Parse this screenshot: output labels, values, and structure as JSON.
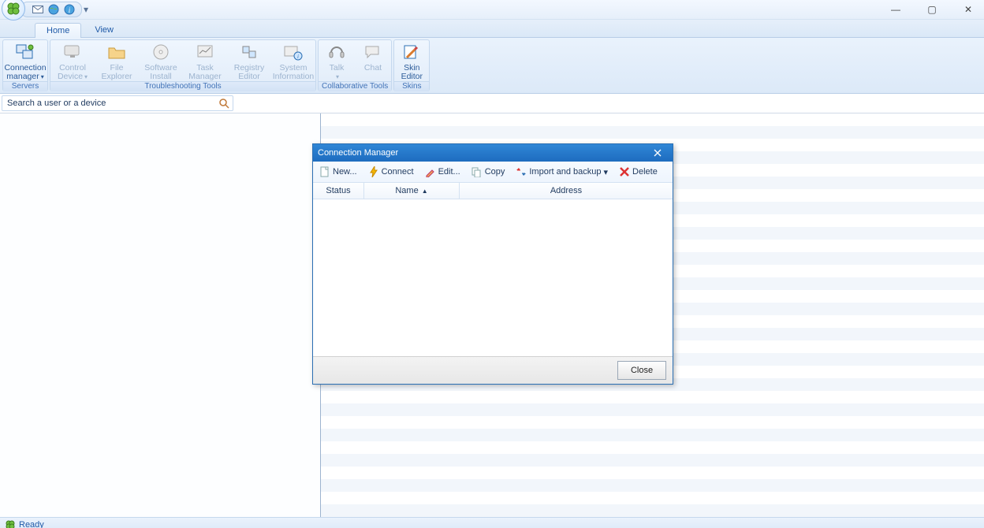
{
  "titlebar": {
    "qat_separator": "▾"
  },
  "window_controls": {
    "minimize": "—",
    "maximize": "▢",
    "close": "✕"
  },
  "ribbon": {
    "tabs": [
      {
        "label": "Home",
        "active": true
      },
      {
        "label": "View",
        "active": false
      }
    ],
    "groups": {
      "servers": {
        "label": "Servers",
        "connection_manager": "Connection\nmanager"
      },
      "troubleshooting": {
        "label": "Troubleshooting Tools",
        "control_device": "Control\nDevice",
        "file_explorer": "File\nExplorer",
        "software_install": "Software\nInstall",
        "task_manager": "Task\nManager",
        "registry_editor": "Registry\nEditor",
        "system_information": "System\nInformation"
      },
      "collaborative": {
        "label": "Collaborative Tools",
        "talk": "Talk",
        "chat": "Chat"
      },
      "skins": {
        "label": "Skins",
        "skin_editor": "Skin\nEditor"
      }
    }
  },
  "search": {
    "placeholder": "Search a user or a device"
  },
  "statusbar": {
    "text": "Ready"
  },
  "dialog": {
    "title": "Connection Manager",
    "toolbar": {
      "new": "New...",
      "connect": "Connect",
      "edit": "Edit...",
      "copy": "Copy",
      "import_backup": "Import and backup",
      "delete": "Delete"
    },
    "columns": {
      "status": "Status",
      "name": "Name",
      "address": "Address"
    },
    "rows": [],
    "close": "Close"
  }
}
